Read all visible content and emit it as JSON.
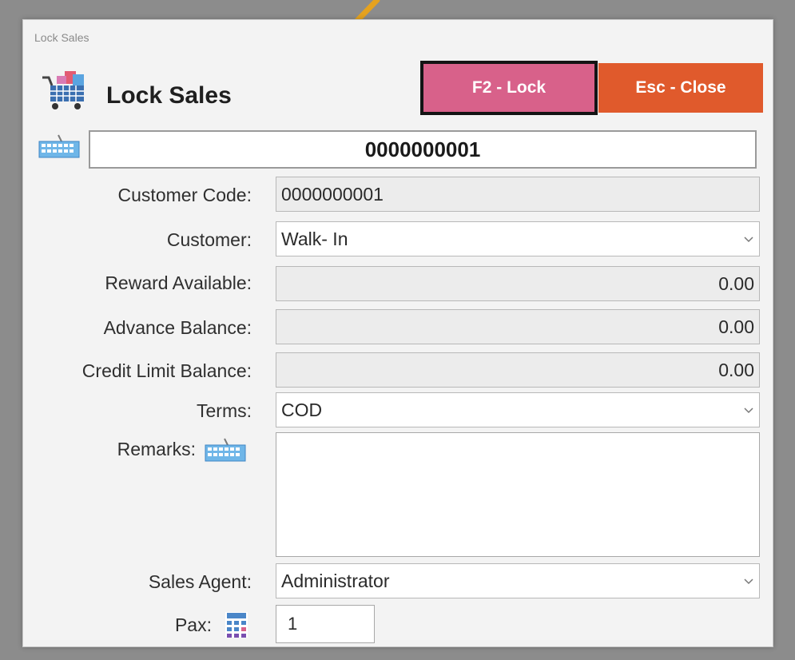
{
  "window": {
    "title": "Lock Sales"
  },
  "header": {
    "title": "Lock Sales",
    "icon": "shopping-cart-icon"
  },
  "toolbar": {
    "lock_label": "F2 - Lock",
    "close_label": "Esc - Close",
    "lock_color": "#d8618a",
    "close_color": "#e05a2c"
  },
  "transaction": {
    "number": "0000000001",
    "icon": "keyboard-icon"
  },
  "form": {
    "customer_code": {
      "label": "Customer Code:",
      "value": "0000000001"
    },
    "customer": {
      "label": "Customer:",
      "value": "Walk- In"
    },
    "reward_available": {
      "label": "Reward Available:",
      "value": "0.00"
    },
    "advance_balance": {
      "label": "Advance Balance:",
      "value": "0.00"
    },
    "credit_limit_balance": {
      "label": "Credit Limit Balance:",
      "value": "0.00"
    },
    "terms": {
      "label": "Terms:",
      "value": "COD"
    },
    "remarks": {
      "label": "Remarks:",
      "value": ""
    },
    "sales_agent": {
      "label": "Sales Agent:",
      "value": "Administrator"
    },
    "pax": {
      "label": "Pax:",
      "value": "1",
      "icon": "calculator-icon"
    }
  },
  "annotation": {
    "icon": "pointer-arrow-icon",
    "color": "#e5a21f"
  }
}
